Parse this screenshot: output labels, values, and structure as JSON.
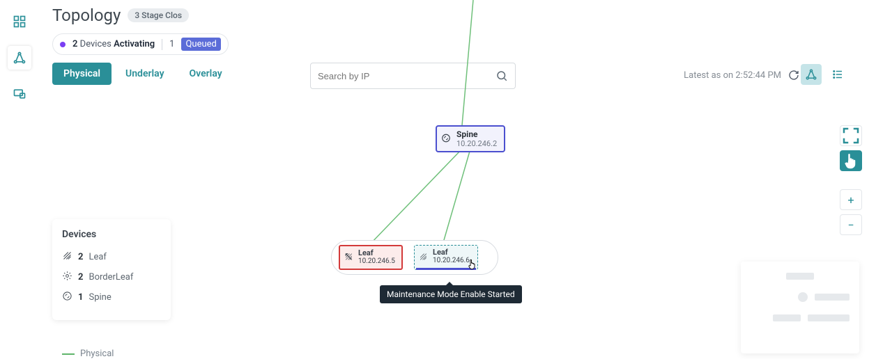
{
  "header": {
    "title": "Topology",
    "stage_badge": "3 Stage Clos"
  },
  "status": {
    "count": "2",
    "text_mid": "Devices",
    "state": "Activating",
    "queued_count": "1",
    "queued_label": "Queued"
  },
  "tabs": {
    "physical": "Physical",
    "underlay": "Underlay",
    "overlay": "Overlay"
  },
  "search": {
    "placeholder": "Search by IP"
  },
  "latest": {
    "label": "Latest as on 2:52:44 PM"
  },
  "devices_panel": {
    "title": "Devices",
    "rows": [
      {
        "count": "2",
        "label": "Leaf"
      },
      {
        "count": "2",
        "label": "BorderLeaf"
      },
      {
        "count": "1",
        "label": "Spine"
      }
    ]
  },
  "legend": {
    "physical": "Physical"
  },
  "nodes": {
    "spine": {
      "label": "Spine",
      "ip": "10.20.246.2"
    },
    "leaf1": {
      "label": "Leaf",
      "ip": "10.20.246.5"
    },
    "leaf2": {
      "label": "Leaf",
      "ip": "10.20.246.6"
    }
  },
  "tooltip": {
    "text": "Maintenance Mode Enable Started"
  },
  "controls": {
    "plus": "+",
    "minus": "−"
  }
}
